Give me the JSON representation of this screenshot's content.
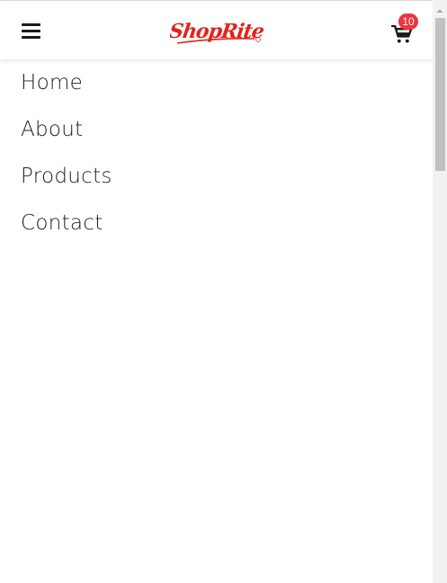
{
  "header": {
    "menu_icon": "hamburger-menu-icon",
    "logo_text": "ShopRite",
    "cart_icon": "shopping-cart-icon",
    "cart_count": "10",
    "colors": {
      "brand_red": "#e2231a",
      "badge": "#ef3340",
      "icon": "#1a1a1a"
    }
  },
  "nav": {
    "items": [
      {
        "label": "Home"
      },
      {
        "label": "About"
      },
      {
        "label": "Products"
      },
      {
        "label": "Contact"
      }
    ]
  },
  "scrollbar": {
    "up_icon": "scroll-up-arrow-icon"
  }
}
